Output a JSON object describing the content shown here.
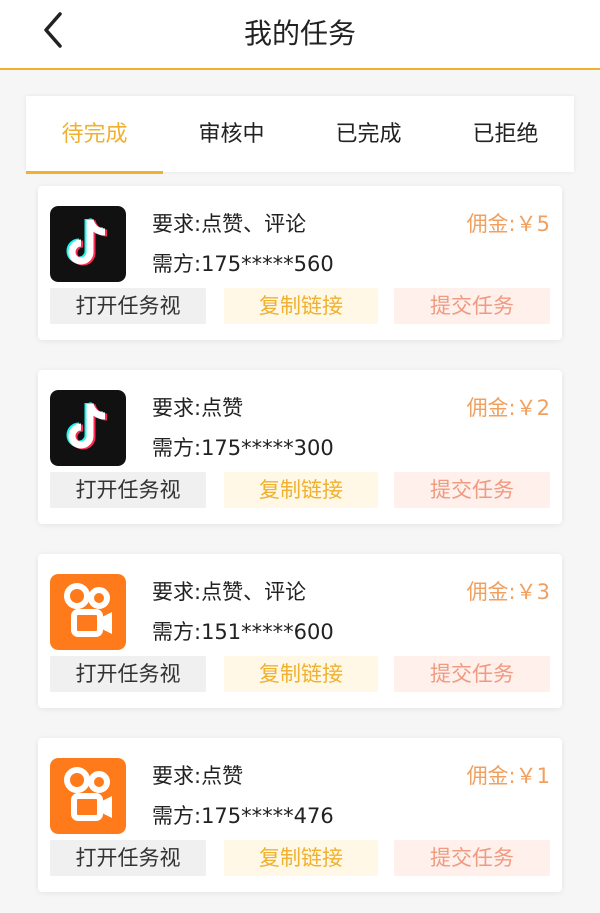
{
  "header": {
    "title": "我的任务"
  },
  "tabs": [
    {
      "label": "待完成"
    },
    {
      "label": "审核中"
    },
    {
      "label": "已完成"
    },
    {
      "label": "已拒绝"
    }
  ],
  "active_tab": 0,
  "colors": {
    "accent": "#f0b030",
    "commission": "#f0a060",
    "submit": "#f09a80"
  },
  "tasks": [
    {
      "app_icon": "douyin-icon",
      "requirement": "要求:点赞、评论",
      "buyer": "需方:175*****560",
      "commission": "佣金:￥5",
      "buttons": {
        "open": "打开任务视",
        "copy": "复制链接",
        "submit": "提交任务"
      }
    },
    {
      "app_icon": "douyin-icon",
      "requirement": "要求:点赞",
      "buyer": "需方:175*****300",
      "commission": "佣金:￥2",
      "buttons": {
        "open": "打开任务视",
        "copy": "复制链接",
        "submit": "提交任务"
      }
    },
    {
      "app_icon": "kuaishou-icon",
      "requirement": "要求:点赞、评论",
      "buyer": "需方:151*****600",
      "commission": "佣金:￥3",
      "buttons": {
        "open": "打开任务视",
        "copy": "复制链接",
        "submit": "提交任务"
      }
    },
    {
      "app_icon": "kuaishou-icon",
      "requirement": "要求:点赞",
      "buyer": "需方:175*****476",
      "commission": "佣金:￥1",
      "buttons": {
        "open": "打开任务视",
        "copy": "复制链接",
        "submit": "提交任务"
      }
    }
  ]
}
